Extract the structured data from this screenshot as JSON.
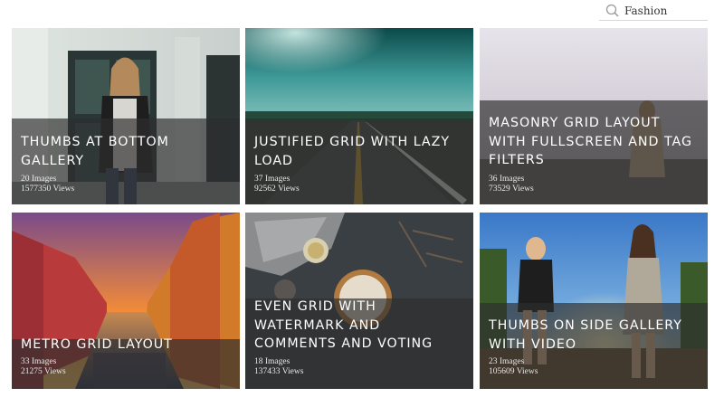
{
  "search": {
    "value": "Fashion",
    "icon": "search-icon"
  },
  "galleries": [
    {
      "title_lines": [
        "Thumbs at bottom",
        "gallery"
      ],
      "images": "20 Images",
      "views": "1577350 Views"
    },
    {
      "title_lines": [
        "Justified grid with lazy",
        "load"
      ],
      "images": "37 Images",
      "views": "92562 Views"
    },
    {
      "title_lines": [
        "Masonry grid layout",
        "with fullscreen and tag",
        "filters"
      ],
      "images": "36 Images",
      "views": "73529 Views"
    },
    {
      "title_lines": [
        "Metro grid layout"
      ],
      "images": "33 Images",
      "views": "21275 Views"
    },
    {
      "title_lines": [
        "Even grid with",
        "watermark and",
        "comments and voting"
      ],
      "images": "18 Images",
      "views": "137433 Views"
    },
    {
      "title_lines": [
        "Thumbs on side gallery",
        "with video"
      ],
      "images": "23 Images",
      "views": "105609 Views"
    }
  ]
}
